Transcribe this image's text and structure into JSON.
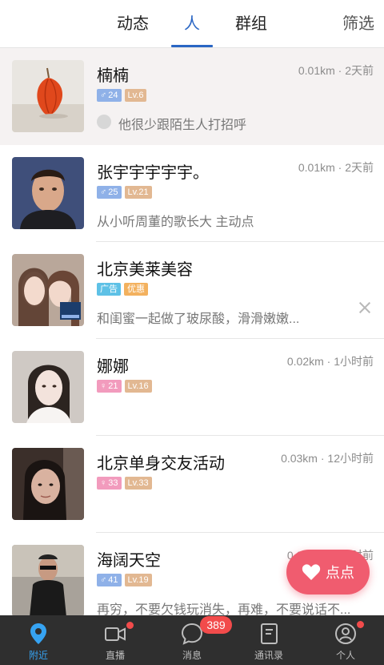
{
  "tabs": {
    "moments": "动态",
    "people": "人",
    "groups": "群组",
    "filter": "筛选"
  },
  "people": [
    {
      "name": "楠楠",
      "meta": "0.01km · 2天前",
      "gender": "male",
      "age": "24",
      "level": "Lv.6",
      "sub": "他很少跟陌生人打招呼"
    },
    {
      "name": "张宇宇宇宇宇。",
      "meta": "0.01km · 2天前",
      "gender": "male",
      "age": "25",
      "level": "Lv.21",
      "sub": "从小听周董的歌长大  主动点"
    },
    {
      "name": "北京美莱美容",
      "ad": "广告",
      "promo": "优惠",
      "sub": "和闺蜜一起做了玻尿酸，滑滑嫩嫩..."
    },
    {
      "name": "娜娜",
      "meta": "0.02km · 1小时前",
      "gender": "female",
      "age": "21",
      "level": "Lv.16",
      "sub": ""
    },
    {
      "name": "北京单身交友活动",
      "meta": "0.03km · 12小时前",
      "gender": "female",
      "age": "33",
      "level": "Lv.33",
      "sub": ""
    },
    {
      "name": "海阔天空",
      "meta": "0.05km · 3小时前",
      "gender": "male",
      "age": "41",
      "level": "Lv.19",
      "sub": "再穷，不要欠钱玩消失，再难，不要说话不..."
    }
  ],
  "fab": {
    "label": "点点"
  },
  "bottom_nav": {
    "nearby": "附近",
    "live": "直播",
    "messages": "消息",
    "messages_count": "389",
    "contacts": "通讯录",
    "profile": "个人"
  },
  "colors": {
    "accent": "#2a66c4",
    "nav_active": "#36a3f2",
    "fab": "#f05c6f",
    "badge_red": "#f24b4b"
  }
}
